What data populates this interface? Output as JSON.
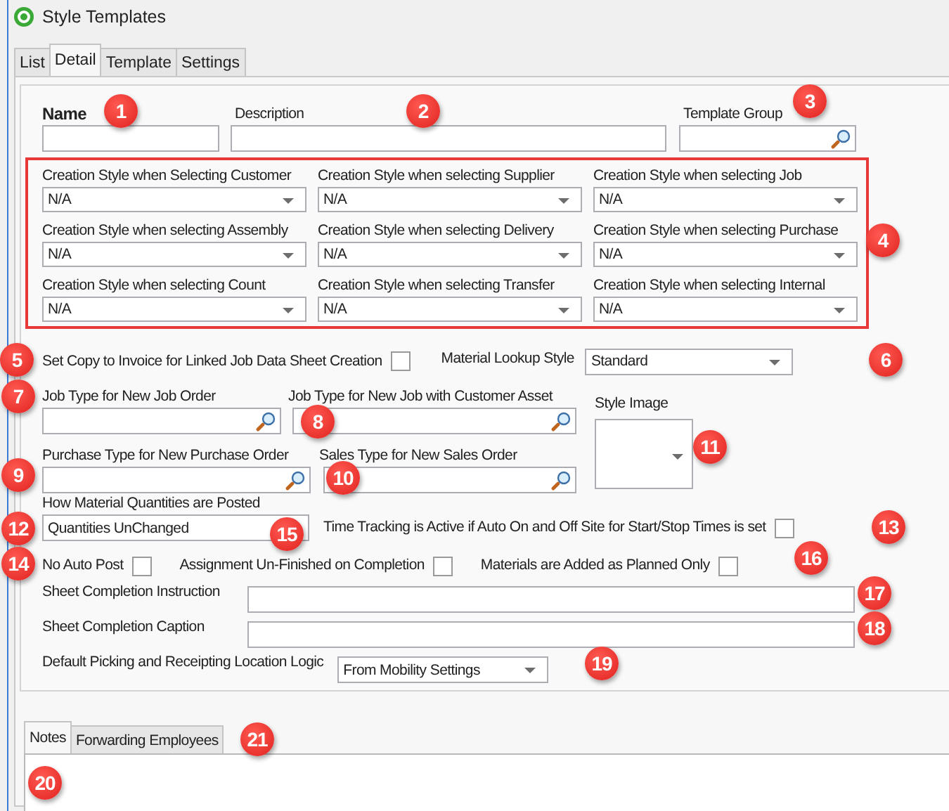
{
  "window": {
    "title": "Style Templates"
  },
  "tabs": [
    {
      "label": "List",
      "selected": false
    },
    {
      "label": "Detail",
      "selected": true
    },
    {
      "label": "Template",
      "selected": false
    },
    {
      "label": "Settings",
      "selected": false
    }
  ],
  "header_fields": [
    {
      "label": "Name",
      "kind": "text",
      "required": true
    },
    {
      "label": "Description",
      "kind": "text",
      "required": false
    },
    {
      "label": "Template Group",
      "kind": "lookup",
      "required": false
    }
  ],
  "creation_styles": [
    {
      "label": "Creation Style when Selecting Customer",
      "value": "N/A"
    },
    {
      "label": "Creation Style when selecting Supplier",
      "value": "N/A"
    },
    {
      "label": "Creation Style when selecting Job",
      "value": "N/A"
    },
    {
      "label": "Creation Style when selecting Assembly",
      "value": "N/A"
    },
    {
      "label": "Creation Style when selecting Delivery",
      "value": "N/A"
    },
    {
      "label": "Creation Style when selecting Purchase",
      "value": "N/A"
    },
    {
      "label": "Creation Style when selecting Count",
      "value": "N/A"
    },
    {
      "label": "Creation Style when selecting Transfer",
      "value": "N/A"
    },
    {
      "label": "Creation Style when selecting Internal",
      "value": "N/A"
    }
  ],
  "copy_to_invoice": {
    "label": "Set Copy to Invoice for Linked Job Data Sheet Creation",
    "checked": false
  },
  "material_lookup_style": {
    "label": "Material Lookup Style",
    "value": "Standard"
  },
  "type_fields": [
    {
      "label": "Job Type for New Job Order"
    },
    {
      "label": "Job Type for New Job with Customer Asset"
    },
    {
      "label": "Purchase Type for New Purchase Order"
    },
    {
      "label": "Sales Type for New Sales Order"
    }
  ],
  "style_image": {
    "label": "Style Image"
  },
  "material_quantities": {
    "label": "How Material Quantities are Posted",
    "value": "Quantities UnChanged"
  },
  "time_tracking": {
    "label": "Time Tracking is Active if Auto On and Off Site for Start/Stop Times is set",
    "checked": false
  },
  "options": [
    {
      "label": "No Auto Post",
      "checked": false
    },
    {
      "label": "Assignment Un-Finished on Completion",
      "checked": false
    },
    {
      "label": "Materials are Added as Planned Only",
      "checked": false
    }
  ],
  "sheet_fields": [
    {
      "label": "Sheet Completion Instruction"
    },
    {
      "label": "Sheet Completion Caption"
    }
  ],
  "location_logic": {
    "label": "Default Picking and Receipting Location Logic",
    "value": "From Mobility Settings"
  },
  "bottom_tabs": [
    {
      "label": "Notes",
      "selected": true
    },
    {
      "label": "Forwarding Employees",
      "selected": false
    }
  ],
  "callouts": [
    "1",
    "2",
    "3",
    "4",
    "5",
    "6",
    "7",
    "8",
    "9",
    "10",
    "11",
    "12",
    "13",
    "14",
    "15",
    "16",
    "17",
    "18",
    "19",
    "20",
    "21"
  ]
}
